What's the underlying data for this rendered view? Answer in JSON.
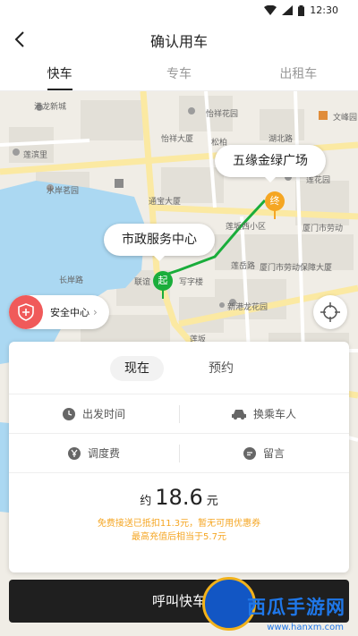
{
  "status_bar": {
    "time": "12:30"
  },
  "header": {
    "title": "确认用车"
  },
  "tabs": [
    {
      "label": "快车",
      "active": true
    },
    {
      "label": "专车",
      "active": false
    },
    {
      "label": "出租车",
      "active": false
    }
  ],
  "map": {
    "destination_label": "五缘金绿广场",
    "destination_pin": "终",
    "origin_label": "市政服务中心",
    "origin_pin": "起",
    "labels": {
      "l1": "港龙新城",
      "l2": "怡祥花园",
      "l3": "文峰园",
      "l4": "莲滨里",
      "l5": "怡祥大厦",
      "l6": "松柏",
      "l7": "湖北路",
      "l8": "水岸茗园",
      "l9": "莲花园",
      "l10": "通宝大厦",
      "l11": "莲坂西小区",
      "l12": "厦门市劳动",
      "l13": "莲岳路",
      "l14": "联谊",
      "l15": "写字楼",
      "l16": "厦门市劳动保障大厦",
      "l17": "新港龙花园",
      "l18": "长岸路",
      "l19": "莲坂"
    },
    "colors": {
      "origin": "#1aad3b",
      "destination": "#f5a623",
      "water": "#abd8f2"
    }
  },
  "safety": {
    "label": "安全中心",
    "icon": "shield-icon"
  },
  "card": {
    "modes": [
      {
        "label": "现在",
        "active": true
      },
      {
        "label": "预约",
        "active": false
      }
    ],
    "options_row1": [
      {
        "label": "出发时间",
        "icon": "clock-icon"
      },
      {
        "label": "换乘车人",
        "icon": "car-icon"
      }
    ],
    "options_row2": [
      {
        "label": "调度费",
        "icon": "yen-icon"
      },
      {
        "label": "留言",
        "icon": "message-icon"
      }
    ],
    "price": {
      "approx": "约",
      "value": "18.6",
      "unit": "元"
    },
    "notes": [
      "免费接送已抵扣11.3元，暂无可用优惠券",
      "最高充值后相当于5.7元"
    ]
  },
  "call_button": {
    "label": "呼叫快车"
  },
  "watermark": {
    "text": "西瓜手游网",
    "url": "www.hanxm.com"
  }
}
